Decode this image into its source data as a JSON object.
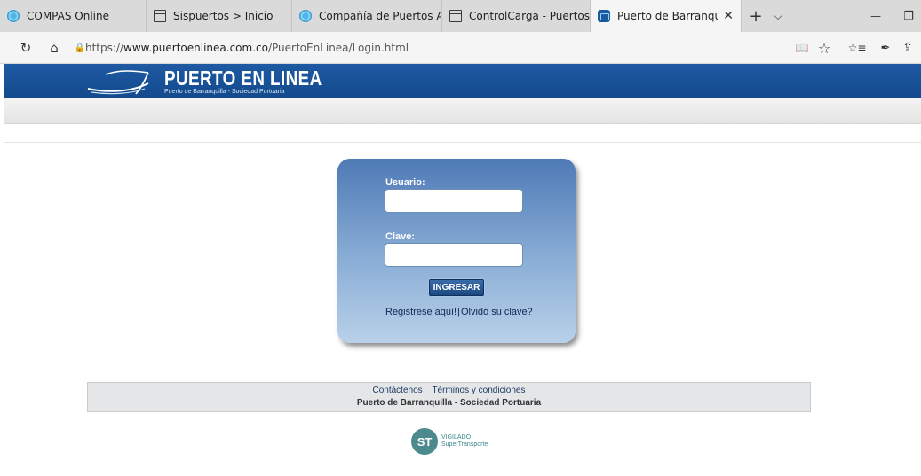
{
  "browser": {
    "tabs": [
      {
        "label": "COMPAS Online",
        "icon": "compas-favicon"
      },
      {
        "label": "Sispuertos > Inicio",
        "icon": "page-favicon"
      },
      {
        "label": "Compañía de Puertos Asoci",
        "icon": "compas-favicon"
      },
      {
        "label": "ControlCarga - Puertos [ Lo",
        "icon": "page-favicon"
      },
      {
        "label": "Puerto de Barranquilla -",
        "icon": "puerto-favicon",
        "active": true
      }
    ],
    "tab_close": "✕",
    "new_tab": "+",
    "tab_menu": "⌵",
    "minimize": "—",
    "restore": "❐",
    "back": "↻",
    "home": "⌂",
    "lock": "🔒",
    "url_prefix": "https://",
    "url_host": "www.puertoenlinea.com.co",
    "url_path": "/PuertoEnLinea/Login.html",
    "reading_view": "📖",
    "favorite": "☆",
    "favorites_bar": "☆≡",
    "pen": "✒",
    "share": "⇪"
  },
  "header": {
    "title": "PUERTO EN LINEA",
    "subtitle": "Puerto de Barranquilla - Sociedad Portuaria",
    "color": "#1a5298"
  },
  "login": {
    "usuario_label": "Usuario:",
    "usuario_value": "",
    "clave_label": "Clave:",
    "clave_value": "",
    "button_label": "INGRESAR",
    "register_link": "Registrese aquí!",
    "separator": "|",
    "forgot_link": "Olvidó su clave?"
  },
  "footer": {
    "contact": "Contáctenos",
    "terms": "Términos y condiciones",
    "company": "Puerto de Barranquilla - Sociedad Portuaria"
  },
  "vigilado": {
    "badge": "ST",
    "line1": "VIGILADO",
    "line2": "SuperTransporte"
  }
}
